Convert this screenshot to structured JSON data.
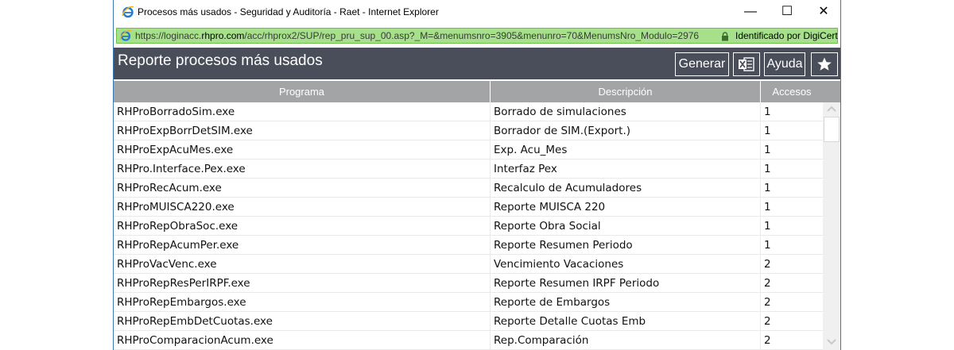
{
  "window": {
    "title": "Procesos más usados - Seguridad y Auditoría - Raet - Internet Explorer",
    "minimize_glyph": "—",
    "maximize_glyph": "☐",
    "close_glyph": "✕"
  },
  "address_bar": {
    "url_prefix": "https://loginacc.",
    "url_domain": "rhpro.com",
    "url_rest": "/acc/rhprox2/SUP/rep_pru_sup_00.asp?_M=&menumsnro=3905&menunro=70&MenumsNro_Modulo=2976",
    "identity": "Identificado por DigiCert"
  },
  "header": {
    "title": "Reporte procesos más usados",
    "buttons": {
      "generar": "Generar",
      "ayuda": "Ayuda"
    }
  },
  "table": {
    "columns": [
      "Programa",
      "Descripción",
      "Accesos"
    ],
    "rows": [
      {
        "programa": "RHProBorradoSim.exe",
        "descripcion": "Borrado de simulaciones",
        "accesos": "1"
      },
      {
        "programa": "RHProExpBorrDetSIM.exe",
        "descripcion": "Borrador de SIM.(Export.)",
        "accesos": "1"
      },
      {
        "programa": "RHProExpAcuMes.exe",
        "descripcion": "Exp. Acu_Mes",
        "accesos": "1"
      },
      {
        "programa": "RHPro.Interface.Pex.exe",
        "descripcion": "Interfaz Pex",
        "accesos": "1"
      },
      {
        "programa": "RHProRecAcum.exe",
        "descripcion": "Recalculo de Acumuladores",
        "accesos": "1"
      },
      {
        "programa": "RHProMUISCA220.exe",
        "descripcion": "Reporte MUISCA 220",
        "accesos": "1"
      },
      {
        "programa": "RHProRepObraSoc.exe",
        "descripcion": "Reporte Obra Social",
        "accesos": "1"
      },
      {
        "programa": "RHProRepAcumPer.exe",
        "descripcion": "Reporte Resumen Periodo",
        "accesos": "1"
      },
      {
        "programa": "RHProVacVenc.exe",
        "descripcion": "Vencimiento Vacaciones",
        "accesos": "2"
      },
      {
        "programa": "RHProRepResPerIRPF.exe",
        "descripcion": "Reporte Resumen IRPF Periodo",
        "accesos": "2"
      },
      {
        "programa": "RHProRepEmbargos.exe",
        "descripcion": "Reporte de Embargos",
        "accesos": "2"
      },
      {
        "programa": "RHProRepEmbDetCuotas.exe",
        "descripcion": "Reporte Detalle Cuotas Emb",
        "accesos": "2"
      },
      {
        "programa": "RHProComparacionAcum.exe",
        "descripcion": "Rep.Comparación",
        "accesos": "2"
      }
    ]
  },
  "icons": {
    "browser": "internet-explorer-icon",
    "lock": "lock-icon",
    "excel": "excel-icon",
    "favorite": "star-icon",
    "scroll_up": "chevron-up-icon",
    "scroll_down": "chevron-down-icon"
  },
  "colors": {
    "header_bg": "#4a4e5a",
    "table_header_bg": "#a3a4a6",
    "address_bar_bg": "#a6e08a",
    "ie_blue": "#1f7ad6"
  }
}
